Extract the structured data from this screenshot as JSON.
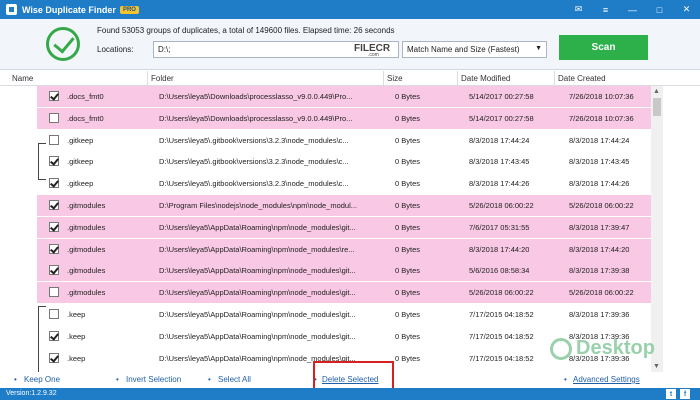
{
  "window": {
    "title": "Wise Duplicate Finder",
    "badge": "PRO"
  },
  "header": {
    "status": "Found 53053 groups of duplicates, a total of 149600 files. Elapsed time: 26 seconds",
    "locations_label": "Locations:",
    "locations_value": "D:\\;",
    "mode": "Match Name and Size (Fastest)",
    "scan_label": "Scan",
    "watermark": "FILECR",
    "watermark_sub": ".com"
  },
  "columns": [
    "Name",
    "Folder",
    "Size",
    "Date Modified",
    "Date Created"
  ],
  "rows": [
    {
      "checked": true,
      "name": ".docs_fmt0",
      "folder": "D:\\Users\\leya5\\Downloads\\processlasso_v9.0.0.449\\Pro...",
      "size": "0 Bytes",
      "modified": "5/14/2017 00:27:58",
      "created": "7/26/2018 10:07:36",
      "hl": true
    },
    {
      "checked": false,
      "name": ".docs_fmt0",
      "folder": "D:\\Users\\leya5\\Downloads\\processlasso_v9.0.0.449\\Pro...",
      "size": "0 Bytes",
      "modified": "5/14/2017 00:27:58",
      "created": "7/26/2018 10:07:36",
      "hl": true
    },
    {
      "checked": false,
      "name": ".gitkeep",
      "folder": "D:\\Users\\leya5\\.gitbook\\versions\\3.2.3\\node_modules\\c...",
      "size": "0 Bytes",
      "modified": "8/3/2018 17:44:24",
      "created": "8/3/2018 17:44:24",
      "hl": false
    },
    {
      "checked": true,
      "name": ".gitkeep",
      "folder": "D:\\Users\\leya5\\.gitbook\\versions\\3.2.3\\node_modules\\c...",
      "size": "0 Bytes",
      "modified": "8/3/2018 17:43:45",
      "created": "8/3/2018 17:43:45",
      "hl": false
    },
    {
      "checked": true,
      "name": ".gitkeep",
      "folder": "D:\\Users\\leya5\\.gitbook\\versions\\3.2.3\\node_modules\\c...",
      "size": "0 Bytes",
      "modified": "8/3/2018 17:44:26",
      "created": "8/3/2018 17:44:26",
      "hl": false
    },
    {
      "checked": true,
      "name": ".gitmodules",
      "folder": "D:\\Program Files\\nodejs\\node_modules\\npm\\node_modul...",
      "size": "0 Bytes",
      "modified": "5/26/2018 06:00:22",
      "created": "5/26/2018 06:00:22",
      "hl": true
    },
    {
      "checked": true,
      "name": ".gitmodules",
      "folder": "D:\\Users\\leya5\\AppData\\Roaming\\npm\\node_modules\\git...",
      "size": "0 Bytes",
      "modified": "7/6/2017 05:31:55",
      "created": "8/3/2018 17:39:47",
      "hl": true
    },
    {
      "checked": true,
      "name": ".gitmodules",
      "folder": "D:\\Users\\leya5\\AppData\\Roaming\\npm\\node_modules\\re...",
      "size": "0 Bytes",
      "modified": "8/3/2018 17:44:20",
      "created": "8/3/2018 17:44:20",
      "hl": true
    },
    {
      "checked": true,
      "name": ".gitmodules",
      "folder": "D:\\Users\\leya5\\AppData\\Roaming\\npm\\node_modules\\git...",
      "size": "0 Bytes",
      "modified": "5/6/2016 08:58:34",
      "created": "8/3/2018 17:39:38",
      "hl": true
    },
    {
      "checked": false,
      "name": ".gitmodules",
      "folder": "D:\\Users\\leya5\\AppData\\Roaming\\npm\\node_modules\\git...",
      "size": "0 Bytes",
      "modified": "5/26/2018 06:00:22",
      "created": "5/26/2018 06:00:22",
      "hl": true
    },
    {
      "checked": false,
      "name": ".keep",
      "folder": "D:\\Users\\leya5\\AppData\\Roaming\\npm\\node_modules\\git...",
      "size": "0 Bytes",
      "modified": "7/17/2015 04:18:52",
      "created": "8/3/2018 17:39:36",
      "hl": false
    },
    {
      "checked": true,
      "name": ".keep",
      "folder": "D:\\Users\\leya5\\AppData\\Roaming\\npm\\node_modules\\git...",
      "size": "0 Bytes",
      "modified": "7/17/2015 04:18:52",
      "created": "8/3/2018 17:39:36",
      "hl": false
    },
    {
      "checked": true,
      "name": ".keep",
      "folder": "D:\\Users\\leya5\\AppData\\Roaming\\npm\\node_modules\\git...",
      "size": "0 Bytes",
      "modified": "7/17/2015 04:18:52",
      "created": "8/3/2018 17:39:36",
      "hl": false
    },
    {
      "checked": true,
      "name": ".keep",
      "folder": "D:\\Users\\leya5\\AppData\\Roaming\\npm\\node_modules\\git...",
      "size": "0 Bytes",
      "modified": "7/17/2015 04:18:52",
      "created": "8/3/2018 17:39:36",
      "hl": false
    }
  ],
  "footer": {
    "keep_one": "Keep One",
    "invert_selection": "Invert Selection",
    "select_all": "Select All",
    "delete_selected": "Delete Selected",
    "advanced_settings": "Advanced Settings"
  },
  "statusbar": {
    "version": "Version:1.2.9.32"
  },
  "overlay": {
    "desktop_watermark": "Desktop"
  }
}
